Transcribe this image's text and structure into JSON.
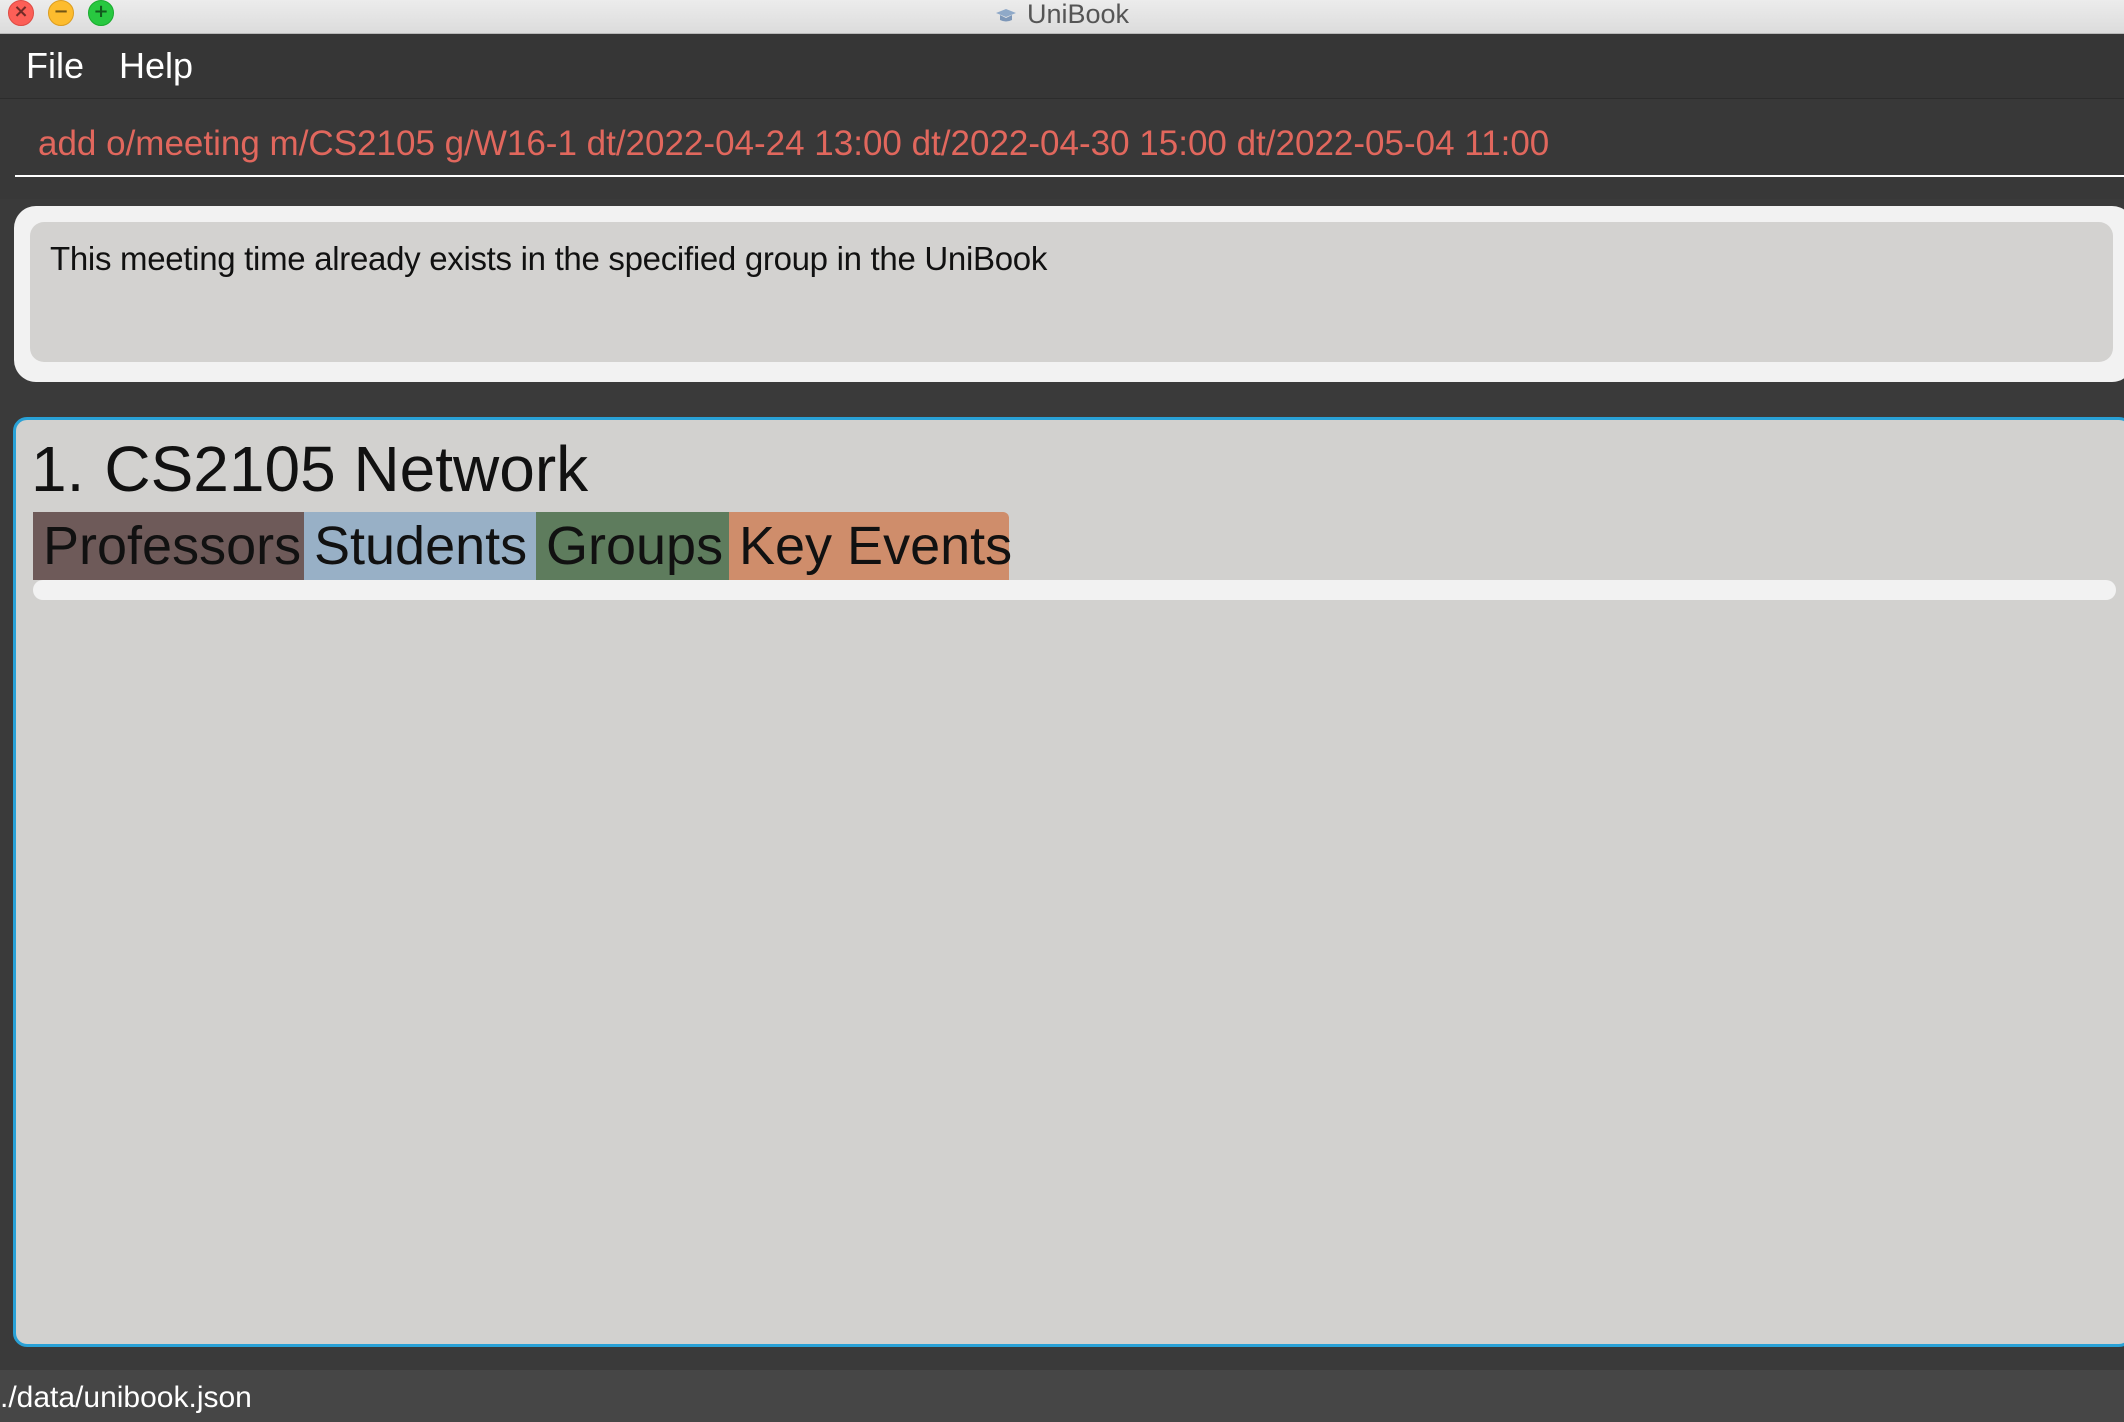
{
  "window": {
    "title": "UniBook",
    "controls": {
      "close_glyph": "×",
      "minimize_glyph": "−",
      "maximize_glyph": "+"
    }
  },
  "menu": {
    "items": [
      {
        "label": "File"
      },
      {
        "label": "Help"
      }
    ]
  },
  "command_box": {
    "value": "add o/meeting m/CS2105 g/W16-1 dt/2022-04-24 13:00 dt/2022-04-30 15:00 dt/2022-05-04 11:00",
    "text_color": "#e1675d"
  },
  "result_display": {
    "message": "This meeting time already exists in the specified group in the UniBook"
  },
  "module_list": {
    "cards": [
      {
        "index": "1.",
        "name": "CS2105 Network",
        "tabs": [
          {
            "label": "Professors",
            "color": "#6e5a59"
          },
          {
            "label": "Students",
            "color": "#98b0c6"
          },
          {
            "label": "Groups",
            "color": "#5e7c5d"
          },
          {
            "label": "Key Events",
            "color": "#cf8d6b"
          }
        ]
      }
    ],
    "border_color": "#29a1d6"
  },
  "status_bar": {
    "save_path": "./data/unibook.json"
  }
}
